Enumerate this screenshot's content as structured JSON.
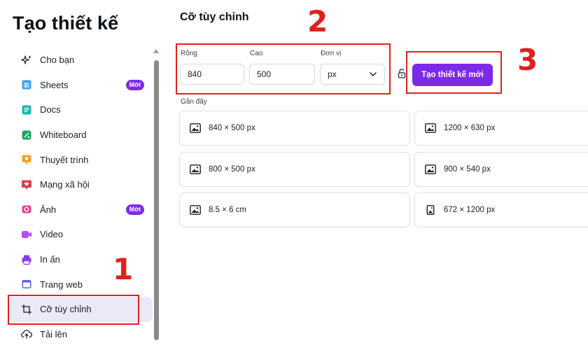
{
  "sidebar": {
    "title": "Tạo thiết kế",
    "items": [
      {
        "label": "Cho bạn",
        "icon": "sparkle-icon"
      },
      {
        "label": "Sheets",
        "icon": "sheets-icon",
        "badge": "Mới"
      },
      {
        "label": "Docs",
        "icon": "docs-icon"
      },
      {
        "label": "Whiteboard",
        "icon": "whiteboard-icon"
      },
      {
        "label": "Thuyết trình",
        "icon": "presentation-icon"
      },
      {
        "label": "Mạng xã hội",
        "icon": "social-media-icon"
      },
      {
        "label": "Ảnh",
        "icon": "photo-icon",
        "badge": "Mới"
      },
      {
        "label": "Video",
        "icon": "video-icon"
      },
      {
        "label": "In ấn",
        "icon": "print-icon"
      },
      {
        "label": "Trang web",
        "icon": "website-icon"
      },
      {
        "label": "Cỡ tùy chỉnh",
        "icon": "custom-size-icon",
        "active": true
      },
      {
        "label": "Tải lên",
        "icon": "upload-icon"
      }
    ]
  },
  "main": {
    "title": "Cỡ tùy chỉnh",
    "width_label": "Rộng",
    "width_value": "840",
    "height_label": "Cao",
    "height_value": "500",
    "unit_label": "Đơn vị",
    "unit_value": "px",
    "create_button": "Tạo thiết kế mới",
    "recent_label": "Gần đây",
    "recent": [
      {
        "label": "840 × 500 px",
        "icon": "image-landscape-icon"
      },
      {
        "label": "1200 × 630 px",
        "icon": "image-landscape-icon"
      },
      {
        "label": "800 × 500 px",
        "icon": "image-landscape-icon"
      },
      {
        "label": "900 × 540 px",
        "icon": "image-landscape-icon"
      },
      {
        "label": "8.5 × 6 cm",
        "icon": "image-landscape-icon"
      },
      {
        "label": "672 × 1200 px",
        "icon": "image-portrait-icon"
      }
    ]
  },
  "annotations": [
    "1",
    "2",
    "3"
  ],
  "colors": {
    "accent": "#7d2ae8",
    "annotation": "#e02020",
    "active_bg": "#ebe8f7"
  }
}
